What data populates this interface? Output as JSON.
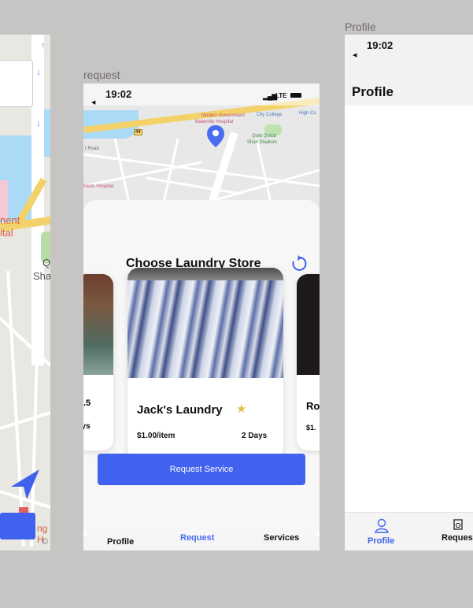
{
  "left_frame": {
    "map_labels": [
      "nent",
      "ital",
      "Q",
      "Sha",
      "ng H",
      "©"
    ]
  },
  "middle_frame": {
    "frame_title": "request",
    "status": {
      "time": "19:02",
      "network": "LTE"
    },
    "map": {
      "labels": [
        "Modern Government",
        "Maternity Hospital",
        "City College",
        "High Co",
        "Qutb Qutub",
        "Shah Stadium",
        "t Road",
        "Meds Hospital",
        "44"
      ]
    },
    "sheet": {
      "title": "Choose Laundry Store",
      "refresh_icon": "refresh-icon",
      "cards": [
        {
          "name": "",
          "rating_partial": ".5",
          "days_partial": "ays"
        },
        {
          "name": "Jack's Laundry",
          "price": "$1.00/item",
          "days": "2 Days",
          "star_icon": "star-icon"
        },
        {
          "name_partial": "Ro",
          "price_partial": "$1."
        }
      ],
      "request_button": "Request Service"
    },
    "tabs": {
      "profile": "Profile",
      "request": "Request",
      "services": "Services"
    },
    "colors": {
      "accent": "#4161ef",
      "pin": "#4a6cf0"
    }
  },
  "right_frame": {
    "frame_title": "Profile",
    "status": {
      "time": "19:02"
    },
    "header_title": "Profile",
    "tabs": {
      "profile": "Profile",
      "request": "Request"
    }
  }
}
